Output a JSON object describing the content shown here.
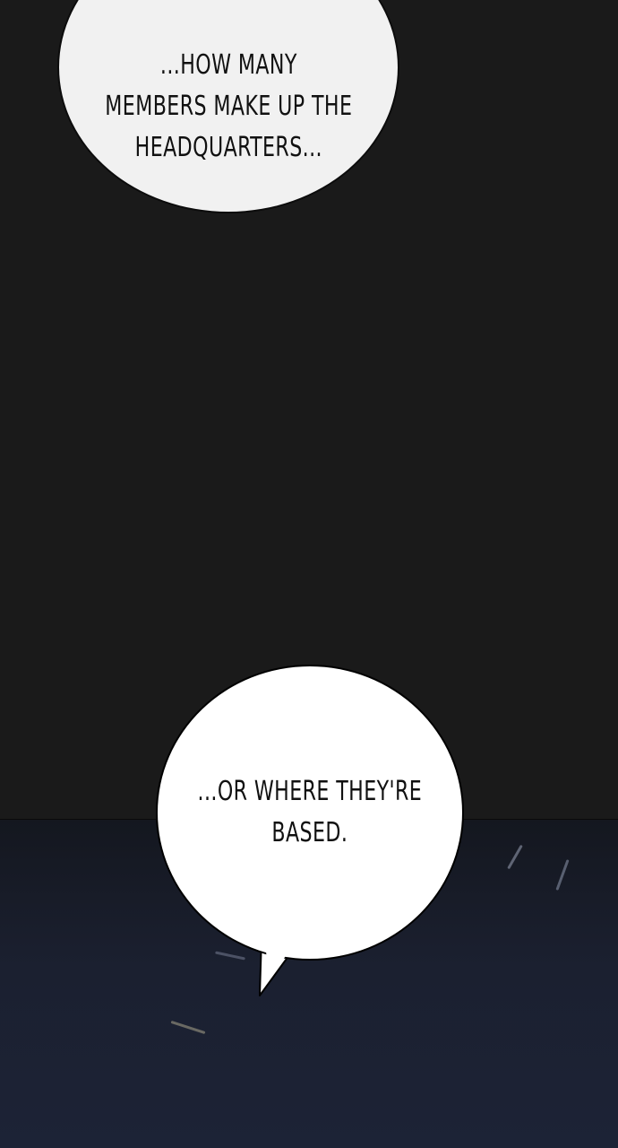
{
  "bubbles": {
    "top": {
      "text": "...HOW MANY\nMEMBERS MAKE UP THE\nHEADQUARTERS..."
    },
    "bottom": {
      "text": "...OR WHERE THEY'RE\nBASED."
    }
  },
  "colors": {
    "background": "#1a1a1a",
    "bubble_top": "#f1f1f1",
    "bubble_bottom": "#ffffff",
    "light_glow": "#e8eeff"
  }
}
